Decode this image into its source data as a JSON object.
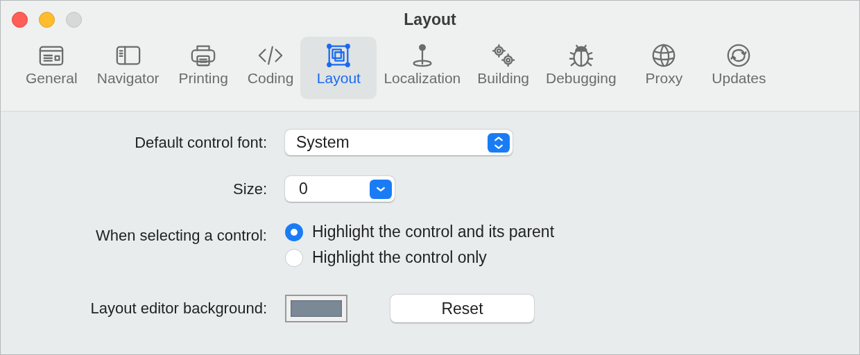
{
  "window": {
    "title": "Layout"
  },
  "tabs": [
    {
      "label": "General",
      "kind": "general",
      "selected": false
    },
    {
      "label": "Navigator",
      "kind": "navigator",
      "selected": false
    },
    {
      "label": "Printing",
      "kind": "printing",
      "selected": false
    },
    {
      "label": "Coding",
      "kind": "coding",
      "selected": false
    },
    {
      "label": "Layout",
      "kind": "layout",
      "selected": true
    },
    {
      "label": "Localization",
      "kind": "localization",
      "selected": false
    },
    {
      "label": "Building",
      "kind": "building",
      "selected": false
    },
    {
      "label": "Debugging",
      "kind": "debugging",
      "selected": false
    },
    {
      "label": "Proxy",
      "kind": "proxy",
      "selected": false
    },
    {
      "label": "Updates",
      "kind": "updates",
      "selected": false
    }
  ],
  "font": {
    "label": "Default control font:",
    "value": "System"
  },
  "size": {
    "label": "Size:",
    "value": "0"
  },
  "selection": {
    "label": "When selecting a control:",
    "options": [
      {
        "label": "Highlight the control and its parent",
        "selected": true
      },
      {
        "label": "Highlight the control only",
        "selected": false
      }
    ]
  },
  "background": {
    "label": "Layout editor background:",
    "color": "#7b8896",
    "reset": "Reset"
  }
}
